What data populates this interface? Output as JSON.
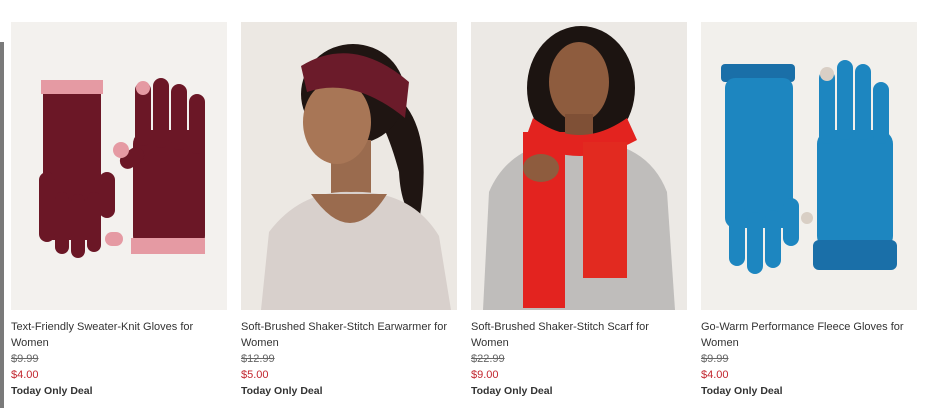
{
  "products": [
    {
      "name": "Text-Friendly Sweater-Knit Gloves for Women",
      "was_price": "$9.99",
      "sale_price": "$4.00",
      "deal": "Today Only Deal"
    },
    {
      "name": "Soft-Brushed Shaker-Stitch Earwarmer for Women",
      "was_price": "$12.99",
      "sale_price": "$5.00",
      "deal": "Today Only Deal"
    },
    {
      "name": "Soft-Brushed Shaker-Stitch Scarf for Women",
      "was_price": "$22.99",
      "sale_price": "$9.00",
      "deal": "Today Only Deal"
    },
    {
      "name": "Go-Warm Performance Fleece Gloves for Women",
      "was_price": "$9.99",
      "sale_price": "$4.00",
      "deal": "Today Only Deal"
    }
  ],
  "colors": {
    "sale": "#c2262e",
    "text": "#333333",
    "muted": "#666666"
  }
}
